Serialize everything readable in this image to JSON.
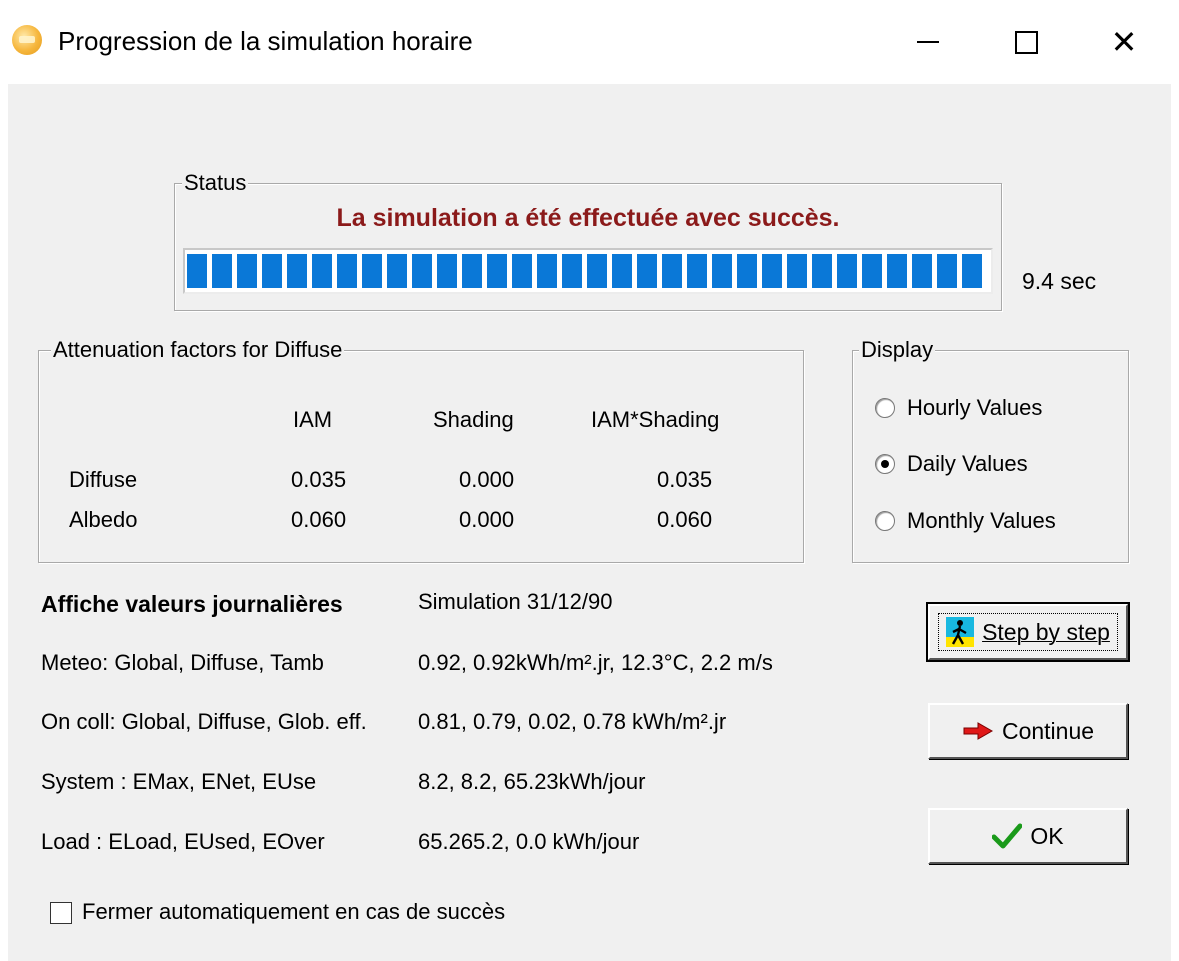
{
  "window": {
    "title": "Progression de la simulation horaire"
  },
  "status": {
    "legend": "Status",
    "message": "La simulation a été effectuée avec succès.",
    "progress_fraction": 1.0,
    "elapsed": "9.4 sec"
  },
  "attenuation": {
    "legend": "Attenuation factors for Diffuse",
    "headers": [
      "IAM",
      "Shading",
      "IAM*Shading"
    ],
    "rows": [
      {
        "label": "Diffuse",
        "values": [
          "0.035",
          "0.000",
          "0.035"
        ]
      },
      {
        "label": "Albedo",
        "values": [
          "0.060",
          "0.000",
          "0.060"
        ]
      }
    ]
  },
  "display": {
    "legend": "Display",
    "options": [
      "Hourly Values",
      "Daily Values",
      "Monthly Values"
    ],
    "selected": "Daily Values"
  },
  "info": {
    "heading": "Affiche valeurs journalières",
    "heading_value": "Simulation 31/12/90",
    "rows": [
      {
        "label": "Meteo:  Global,  Diffuse, Tamb",
        "value": "0.92,  0.92kWh/m².jr,  12.3°C,  2.2 m/s"
      },
      {
        "label": "On coll: Global,  Diffuse, Glob. eff.",
        "value": "0.81,  0.79,  0.02,  0.78 kWh/m².jr"
      },
      {
        "label": "System : EMax, ENet, EUse",
        "value": "8.2,  8.2,  65.23kWh/jour"
      },
      {
        "label": "Load :  ELoad, EUsed, EOver",
        "value": "65.265.2,  0.0 kWh/jour"
      }
    ]
  },
  "buttons": {
    "step": "Step by step",
    "continue": "Continue",
    "ok": "OK"
  },
  "checkbox": {
    "label": "Fermer automatiquement en cas de succès",
    "checked": false
  },
  "icons": {
    "app": "pvsyst-sun-icon",
    "step": "walking-man-icon",
    "continue": "red-arrow-icon",
    "ok": "green-check-icon"
  },
  "colors": {
    "status_message": "#8b1a1a",
    "progress": "#0a78d7",
    "dialog_bg": "#f0f0f0"
  }
}
